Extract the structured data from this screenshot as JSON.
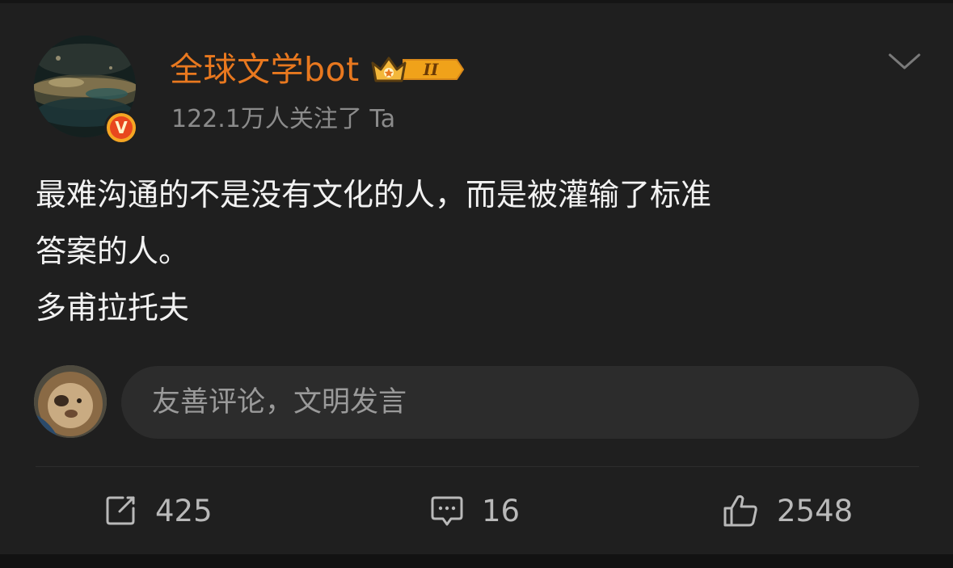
{
  "user": {
    "name": "全球文学bot",
    "rank_label": "II",
    "verified_mark": "V",
    "followers_text": "122.1万人关注了 Ta"
  },
  "post": {
    "lines": [
      "最难沟通的不是没有文化的人，而是被灌输了标准",
      "答案的人。",
      "多甫拉托夫"
    ]
  },
  "comment_box": {
    "placeholder": "友善评论，文明发言"
  },
  "actions": {
    "share_count": "425",
    "comment_count": "16",
    "like_count": "2548"
  },
  "colors": {
    "background": "#1f1f1f",
    "username": "#e8781f",
    "secondary_text": "#8b8b8b",
    "badge_gold": "#f5a623"
  },
  "icons": {
    "menu": "chevron-down-icon",
    "share": "share-icon",
    "comment": "comment-icon",
    "like": "thumbs-up-icon",
    "verified": "verified-badge-icon",
    "rank": "crown-rank-icon"
  }
}
